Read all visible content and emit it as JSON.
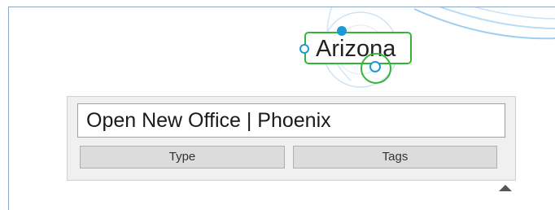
{
  "map": {
    "node_label": "Arizona",
    "node_color": "#35b535",
    "link_color": "#9ccfef",
    "handle_color": "#1a9ad6"
  },
  "editor": {
    "title_value": "Open New Office | Phoenix",
    "type_button_label": "Type",
    "tags_button_label": "Tags"
  },
  "icons": {
    "collapse": "triangle-up-icon"
  }
}
